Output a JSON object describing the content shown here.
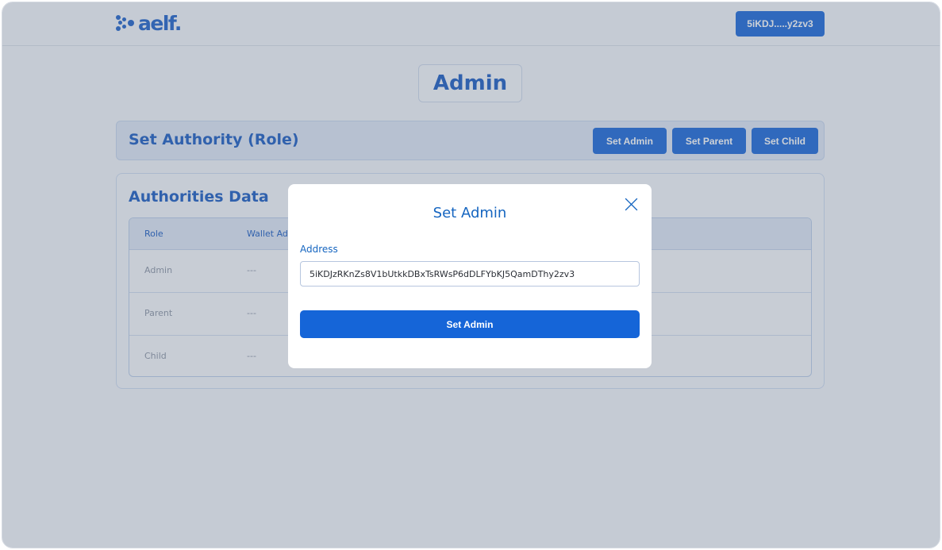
{
  "header": {
    "logo_text": "aelf.",
    "wallet_label": "5iKDJ.....y2zv3"
  },
  "page": {
    "title": "Admin"
  },
  "authority": {
    "title": "Set Authority (Role)",
    "buttons": [
      "Set Admin",
      "Set Parent",
      "Set Child"
    ]
  },
  "data_section": {
    "title": "Authorities Data",
    "columns": [
      "Role",
      "Wallet Address"
    ],
    "rows": [
      {
        "role": "Admin",
        "address": "---"
      },
      {
        "role": "Parent",
        "address": "---"
      },
      {
        "role": "Child",
        "address": "---"
      }
    ]
  },
  "modal": {
    "title": "Set Admin",
    "field_label": "Address",
    "field_value": "5iKDJzRKnZs8V1bUtkkDBxTsRWsP6dDLFYbKJ5QamDThy2zv3",
    "submit_label": "Set Admin",
    "close_icon": "close-icon"
  },
  "colors": {
    "primary": "#1565d8",
    "heading": "#1558c0",
    "overlay": "rgba(102,114,134,0.33)"
  }
}
